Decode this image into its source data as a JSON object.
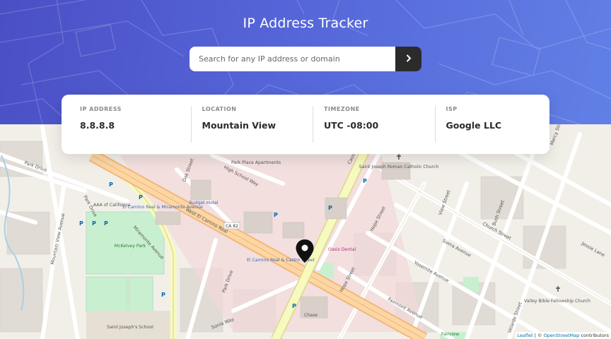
{
  "header": {
    "title": "IP Address Tracker",
    "search_placeholder": "Search for any IP address or domain",
    "search_value": "",
    "submit_icon": "chevron-right-icon"
  },
  "info": [
    {
      "label": "IP ADDRESS",
      "value": "8.8.8.8"
    },
    {
      "label": "LOCATION",
      "value": "Mountain View"
    },
    {
      "label": "TIMEZONE",
      "value": "UTC -08:00"
    },
    {
      "label": "ISP",
      "value": "Google LLC"
    }
  ],
  "map": {
    "streets": {
      "park_drive": "Park Drive",
      "park_drive_2": "Park Drive",
      "mountain_view_ave": "Mountain View Avenue",
      "miramonte_ave": "Miramonte Avenue",
      "high_school_way": "High School Way",
      "oak_street": "Oak Street",
      "castro_street": "Castro Street",
      "w_el_camino": "West El Camino Real",
      "hope_street": "Hope Street",
      "hope_street_2": "Hope Street",
      "view_street": "View Street",
      "bush_street": "Bush Street",
      "church_street": "Church Street",
      "sierra_avenue": "Sierra Avenue",
      "yosemite_avenue": "Yosemite Avenue",
      "fairmont_avenue": "Fairmont Avenue",
      "jessie_lane": "Jessie Lane",
      "mercy_street": "Mercy Street",
      "velarde_street": "Velarde Street",
      "sonia_way": "Sonia Way",
      "park_drive_3": "Park Drive"
    },
    "places": {
      "park_place": "Park Place Apartments",
      "st_joseph_church": "Saint Joseph Roman Catholic Church",
      "aaa": "AAA of California",
      "el_camino_miramonte": "El Camino Real & Miramonte Avenue",
      "el_camino_castro": "El Camino Real & Castro Street",
      "budget_motel": "Budget Motel",
      "mckelvey_park": "McKelvey Park",
      "st_josephs_school": "Saint Joseph's School",
      "valley_bible": "Valley Bible Fellowship Church",
      "ca82": "CA 82",
      "oasis_dental": "Oasis Dental",
      "chase": "Chase",
      "fairview": "Fairview"
    },
    "attribution": {
      "leaflet": "Leaflet",
      "sep": " | © ",
      "osm": "OpenStreetMap",
      "rest": " contributors"
    }
  },
  "colors": {
    "gradient_start": "#4a4fc4",
    "gradient_end": "#6180e6",
    "button_bg": "#2b2b2b",
    "major_road": "#fcd6a4",
    "castro_road": "#f7fabf",
    "park_green": "#c8f0d0"
  }
}
